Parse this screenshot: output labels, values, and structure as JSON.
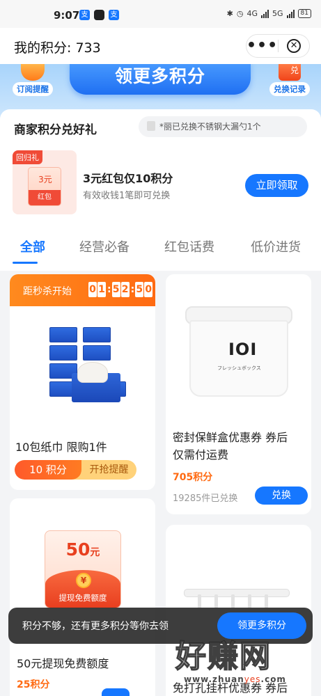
{
  "status_bar": {
    "time": "9:07",
    "app_icons": [
      "支",
      "支"
    ],
    "network": "4G",
    "network2": "5G",
    "battery": "81"
  },
  "header": {
    "title": "我的积分: 733",
    "more_icon": "more-dots-icon",
    "close_icon": "close-circle-icon"
  },
  "banner": {
    "left_chip": "订阅提醒",
    "main_label": "领更多积分",
    "right_chip": "兑换记录"
  },
  "section": {
    "title": "商家积分兑好礼",
    "ticker": "*丽已兑换不锈钢大漏勺1个"
  },
  "promo": {
    "tag": "回归礼",
    "redpack_amount": "3元",
    "redpack_label": "红包",
    "title": "3元红包仅10积分",
    "subtitle": "有效收钱1笔即可兑换",
    "button": "立即领取"
  },
  "tabs": [
    {
      "label": "全部",
      "active": true
    },
    {
      "label": "经营必备",
      "active": false
    },
    {
      "label": "红包话费",
      "active": false
    },
    {
      "label": "低价进货",
      "active": false
    }
  ],
  "products": {
    "flash": {
      "label": "距秒杀开始",
      "countdown": [
        "0",
        "1",
        "5",
        "2",
        "5",
        "0"
      ],
      "name": "10包纸巾 限购1件",
      "points": "10 积分",
      "remind": "开抢提醒"
    },
    "box": {
      "logo": "IOI",
      "logo_text": "フレッシュボックス",
      "name_line1": "密封保鲜盒优惠券 券后",
      "name_line2": "仅需付运费",
      "points": "705积分",
      "redeemed": "19285件已兑换",
      "button": "兑换"
    },
    "cash": {
      "amount": "50",
      "amount_unit": "元",
      "coin": "¥",
      "label": "提现免费额度",
      "name": "50元提现免费额度",
      "points": "25积分"
    },
    "hook": {
      "name": "免打孔挂杆优惠券 券后"
    }
  },
  "toast": {
    "text": "积分不够，还有更多积分等你去领",
    "button": "领更多积分"
  },
  "watermark": {
    "big": "好赚网",
    "url_pre": "www.zhuan",
    "url_mid": "yes",
    "url_post": ".com"
  },
  "colors": {
    "primary": "#1677ff",
    "accent_orange": "#ff6a12",
    "red": "#f04b37"
  }
}
